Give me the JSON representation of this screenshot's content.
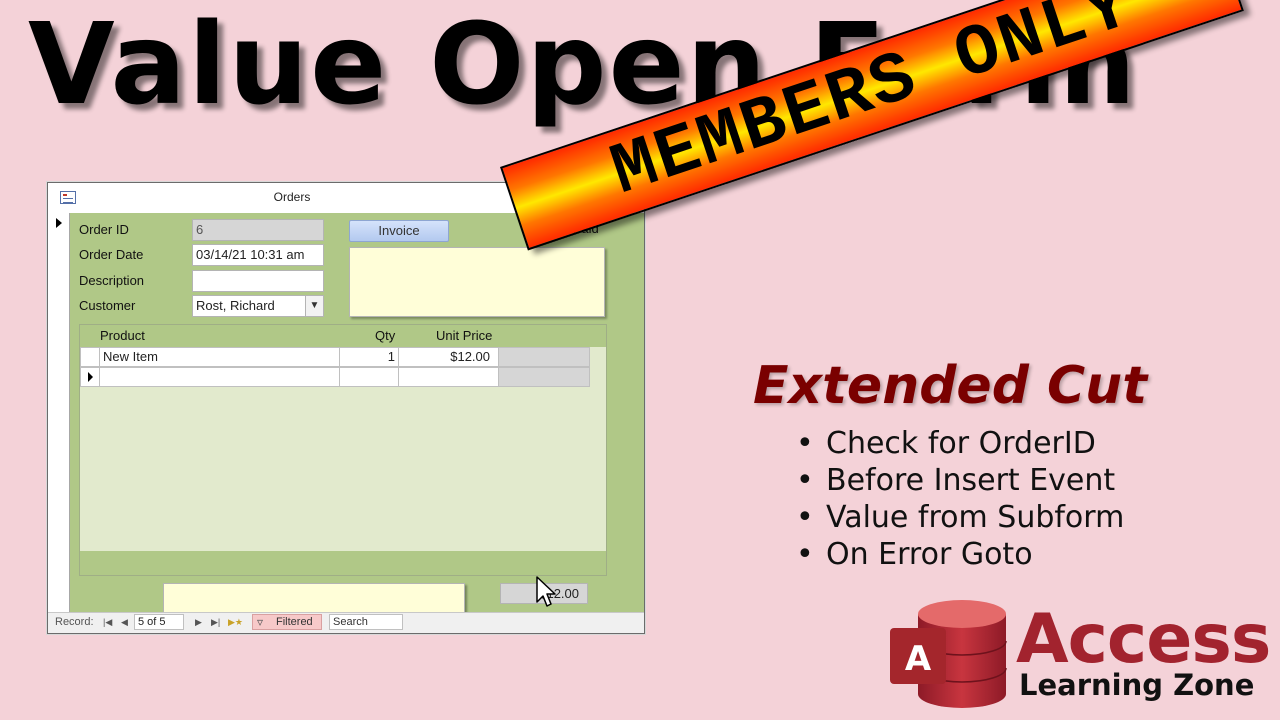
{
  "headline": "Value Open Form",
  "window": {
    "title": "Orders",
    "controls": {
      "minimize": "—",
      "maximize": "☐",
      "close": "✕"
    },
    "form": {
      "order_id_label": "Order ID",
      "order_id_value": "6",
      "order_date_label": "Order Date",
      "order_date_value": "03/14/21 10:31 am",
      "description_label": "Description",
      "description_value": "",
      "customer_label": "Customer",
      "customer_value": "Rost, Richard",
      "invoice_button": "Invoice",
      "is_paid_label": "Is Paid",
      "is_paid_checked": false
    },
    "subform": {
      "columns": [
        "Product",
        "Qty",
        "Unit Price"
      ],
      "rows": [
        {
          "product": "New Item",
          "qty": "1",
          "unit_price": "$12.00"
        }
      ],
      "total": "$12.00"
    },
    "navbar": {
      "record_label": "Record:",
      "position": "5 of 5",
      "filter_label": "Filtered",
      "search_placeholder": "Search",
      "first_icon": "first-record-icon",
      "prev_icon": "previous-record-icon",
      "next_icon": "next-record-icon",
      "last_icon": "last-record-icon",
      "new_icon": "new-record-icon"
    }
  },
  "banner": {
    "text": "MEMBERS ONLY"
  },
  "extended_cut": {
    "title": "Extended Cut",
    "bullets": [
      "Check for OrderID",
      "Before Insert Event",
      "Value from Subform",
      "On Error Goto"
    ]
  },
  "logo": {
    "icon_letter": "A",
    "word": "Access",
    "tagline": "Learning Zone"
  },
  "colors": {
    "background": "#f4d2d8",
    "form_green": "#b0c887",
    "extended_cut": "#7a0000",
    "access_red": "#a2232e"
  }
}
